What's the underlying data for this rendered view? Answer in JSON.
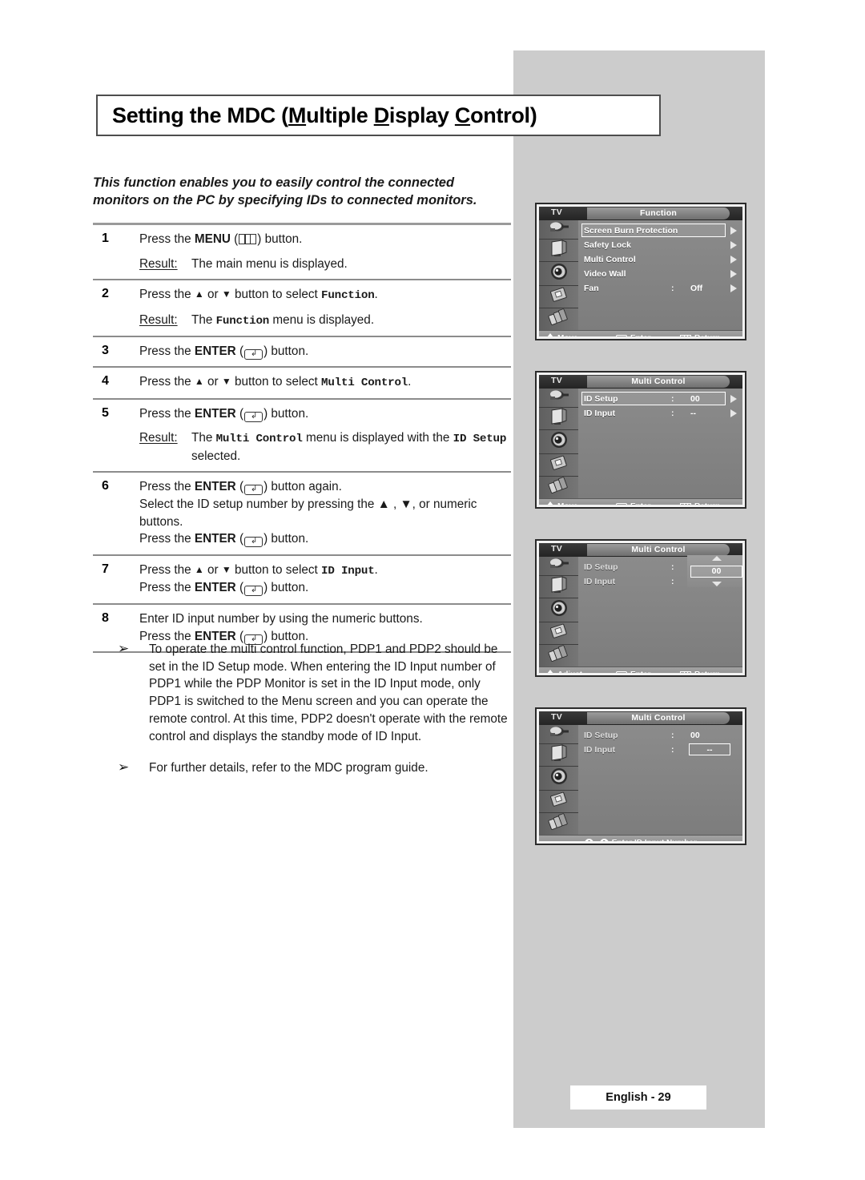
{
  "page": {
    "title_prefix": "Setting the MDC (",
    "title_u1": "M",
    "title_w1": "ultiple ",
    "title_u2": "D",
    "title_w2": "isplay ",
    "title_u3": "C",
    "title_w3": "ontrol)",
    "title_plain": "Setting the MDC (Multiple Display Control)",
    "intro": "This function enables you to easily control the connected monitors on the PC by specifying IDs to connected monitors.",
    "footer": "English - 29"
  },
  "labels": {
    "result": "Result:",
    "press_the": "Press the ",
    "button_suffix": ") button.",
    "menu_word": "MENU",
    "enter_word": "ENTER",
    "or_button_select": " button to select ",
    "bullet": "➢"
  },
  "steps": [
    {
      "num": "1",
      "lines": [
        {
          "pre": "Press the ",
          "bold": "MENU",
          "glyph": "menu-icon",
          "post": ") button."
        }
      ],
      "result_label": "Result:",
      "result_text": "The main menu is displayed."
    },
    {
      "num": "2",
      "lines": [
        {
          "pre": "Press the ",
          "arrows": true,
          "mid": " button to select ",
          "mono": "Function",
          "post": "."
        }
      ],
      "result_label": "Result:",
      "result_text_pre": "The ",
      "result_mono": "Function",
      "result_text_post": " menu is displayed."
    },
    {
      "num": "3",
      "lines": [
        {
          "pre": "Press the ",
          "bold": "ENTER",
          "glyph": "enter-icon",
          "post": ") button."
        }
      ]
    },
    {
      "num": "4",
      "lines": [
        {
          "pre": "Press the ",
          "arrows": true,
          "mid": " button to select ",
          "mono": "Multi Control",
          "post": "."
        }
      ]
    },
    {
      "num": "5",
      "lines": [
        {
          "pre": "Press the ",
          "bold": "ENTER",
          "glyph": "enter-icon",
          "post": ") button."
        }
      ],
      "result_label": "Result:",
      "result_text_pre": "The ",
      "result_mono": "Multi Control",
      "result_text_mid": " menu is displayed with the ",
      "result_mono2": "ID Setup",
      "result_text_post": " selected."
    },
    {
      "num": "6",
      "lines": [
        {
          "pre": "Press the ",
          "bold": "ENTER",
          "glyph": "enter-icon",
          "post": ") button again."
        },
        {
          "plain": "Select the ID setup number by pressing the ▲ , ▼, or numeric buttons."
        },
        {
          "pre": "Press the ",
          "bold": "ENTER",
          "glyph": "enter-icon",
          "post": ") button."
        }
      ]
    },
    {
      "num": "7",
      "lines": [
        {
          "pre": "Press the ",
          "arrows": true,
          "mid": " button to select ",
          "mono": "ID Input",
          "post": "."
        },
        {
          "pre": "Press the ",
          "bold": "ENTER",
          "glyph": "enter-icon",
          "post": ") button."
        }
      ]
    },
    {
      "num": "8",
      "lines": [
        {
          "plain": "Enter ID input number by using the numeric buttons."
        },
        {
          "pre": "Press the ",
          "bold": "ENTER",
          "glyph": "enter-icon",
          "post": ") button."
        }
      ]
    }
  ],
  "notes": [
    {
      "bullet": "➢",
      "text": "To operate the multi control function, PDP1 and PDP2 should be set in the ID Setup mode. When entering the ID Input number of PDP1 while the PDP Monitor is set in the ID Input mode, only PDP1 is switched to the Menu screen and you can operate the remote control. At this time, PDP2 doesn't operate with the remote control and displays the standby mode of ID Input."
    },
    {
      "bullet": "➢",
      "text": "For further details, refer to the MDC program guide."
    }
  ],
  "osd": [
    {
      "tv": "TV",
      "tab": "Function",
      "rows": [
        {
          "label": "Screen Burn Protection",
          "selected": true,
          "arrow": true
        },
        {
          "label": "Safety Lock",
          "selected": false,
          "arrow": true
        },
        {
          "label": "Multi Control",
          "selected": false,
          "arrow": true
        },
        {
          "label": "Video Wall",
          "selected": false,
          "arrow": true
        },
        {
          "label": "Fan",
          "colon": ":",
          "value": "Off",
          "selected": false,
          "arrow": true
        }
      ],
      "footer": [
        {
          "icon": "updown-icon",
          "label": "Move"
        },
        {
          "icon": "enter-icon",
          "label": "Enter"
        },
        {
          "icon": "menu-icon",
          "label": "Return"
        }
      ]
    },
    {
      "tv": "TV",
      "tab": "Multi Control",
      "rows": [
        {
          "label": "ID Setup",
          "colon": ":",
          "value": "00",
          "selected": true,
          "arrow": true
        },
        {
          "label": "ID Input",
          "colon": ":",
          "value": "--",
          "selected": false,
          "arrow": true
        }
      ],
      "footer": [
        {
          "icon": "updown-icon",
          "label": "Move"
        },
        {
          "icon": "enter-icon",
          "label": "Enter"
        },
        {
          "icon": "menu-icon",
          "label": "Return"
        }
      ]
    },
    {
      "tv": "TV",
      "tab": "Multi Control",
      "rows": [
        {
          "label": "ID Setup",
          "colon": ":",
          "dim": true
        },
        {
          "label": "ID Input",
          "colon": ":",
          "dim": true
        }
      ],
      "spinner": {
        "value": "00"
      },
      "footer": [
        {
          "icon": "updown-icon",
          "label": "Adjust"
        },
        {
          "icon": "enter-icon",
          "label": "Enter"
        },
        {
          "icon": "menu-icon",
          "label": "Return"
        }
      ]
    },
    {
      "tv": "TV",
      "tab": "Multi Control",
      "rows": [
        {
          "label": "ID Setup",
          "colon": ":",
          "value": "00",
          "dim": true
        },
        {
          "label": "ID Input",
          "colon": ":",
          "boxvalue": "--",
          "dim": true
        }
      ],
      "footer_single": {
        "zeros": "0..0",
        "label": "Enter ID Input Number"
      }
    }
  ],
  "colors": {
    "panel_grey": "#cccccc",
    "osd_border": "#2b2b2b",
    "osd_body": "#7c7c7c",
    "text": "#1a1a1a"
  }
}
